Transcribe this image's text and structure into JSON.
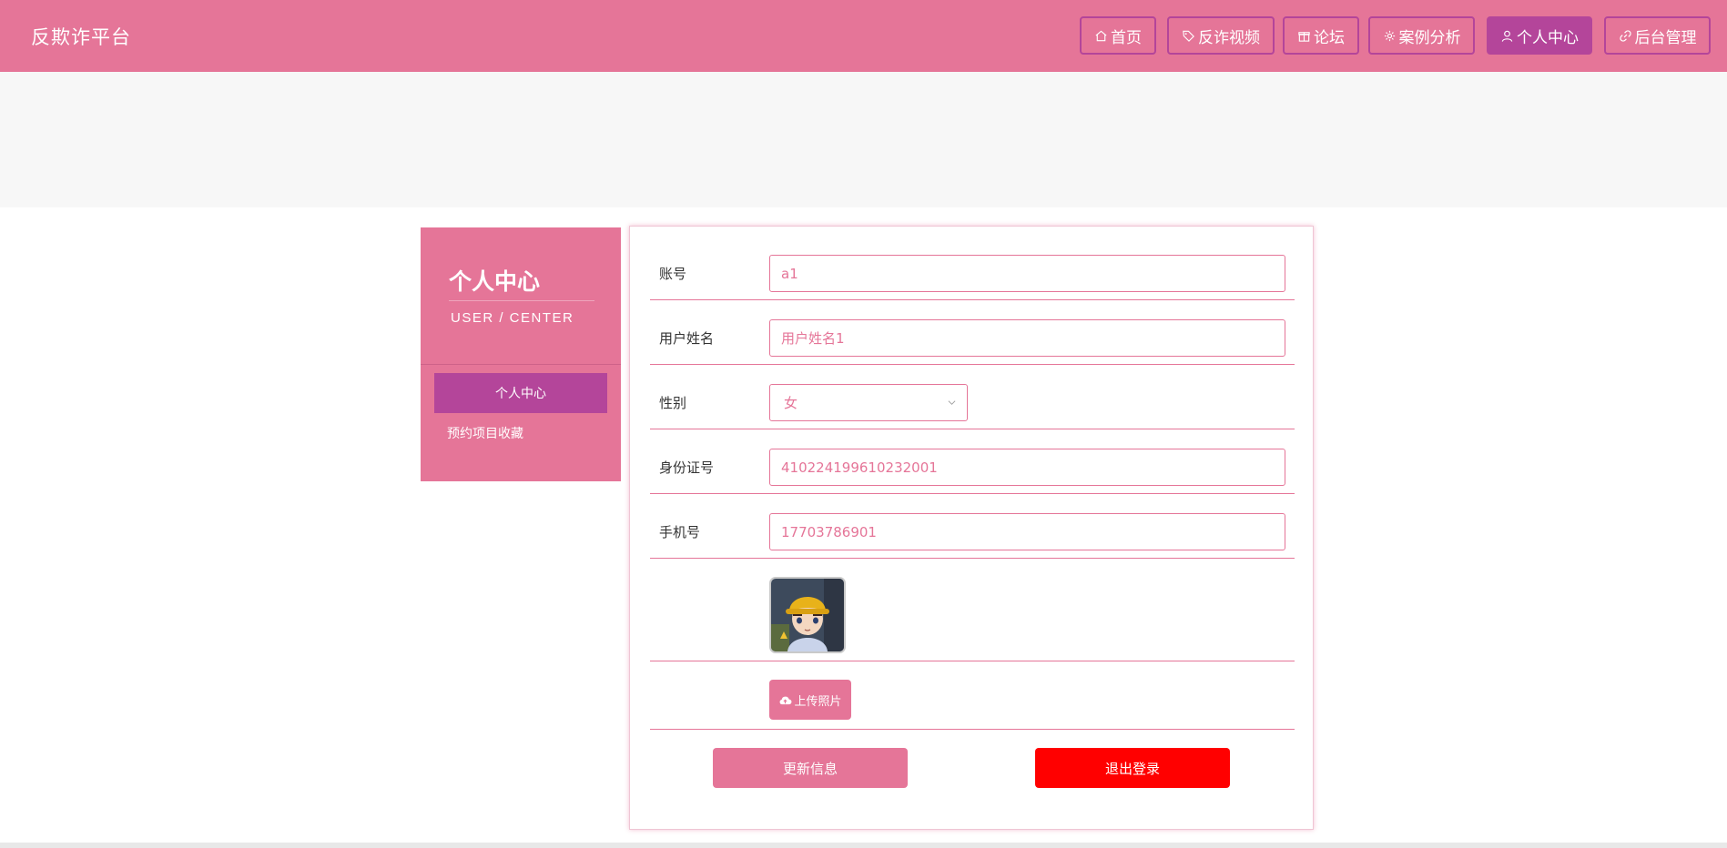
{
  "header": {
    "brand": "反欺诈平台",
    "nav": [
      {
        "label": "首页",
        "icon": "home-icon",
        "active": false
      },
      {
        "label": "反诈视频",
        "icon": "tag-icon",
        "active": false
      },
      {
        "label": "论坛",
        "icon": "gift-icon",
        "active": false
      },
      {
        "label": "案例分析",
        "icon": "settings-icon",
        "active": false
      },
      {
        "label": "个人中心",
        "icon": "user-icon",
        "active": true
      },
      {
        "label": "后台管理",
        "icon": "link-icon",
        "active": false
      }
    ]
  },
  "sidebar": {
    "title": "个人中心",
    "subtitle": "USER / CENTER",
    "items": [
      {
        "label": "个人中心",
        "active": true
      },
      {
        "label": "预约项目收藏",
        "active": false
      }
    ]
  },
  "form": {
    "account": {
      "label": "账号",
      "value": "a1"
    },
    "username": {
      "label": "用户姓名",
      "value": "用户姓名1"
    },
    "gender": {
      "label": "性别",
      "value": "女"
    },
    "id_number": {
      "label": "身份证号",
      "value": "410224199610232001"
    },
    "phone": {
      "label": "手机号",
      "value": "17703786901"
    },
    "upload_label": "上传照片",
    "update_button": "更新信息",
    "logout_button": "退出登录"
  },
  "colors": {
    "primary": "#e57598",
    "active": "#b4459a",
    "danger": "#ff0000",
    "banner": "#f7f7f7"
  }
}
